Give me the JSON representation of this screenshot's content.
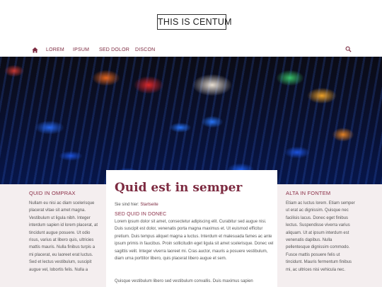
{
  "header": {
    "logo_text": "THIS IS CENTUM"
  },
  "nav": {
    "home_icon": "home-icon",
    "items": [
      {
        "label": "LOREM"
      },
      {
        "label": "IPSUM"
      },
      {
        "label": "SED DOLOR"
      },
      {
        "label": "DISCON"
      }
    ],
    "search_icon": "search-icon"
  },
  "colors": {
    "accent": "#7d2b41",
    "sidebar_bg": "#f4eeef"
  },
  "left_sidebar": {
    "title": "QUID IN OMPRAX",
    "text": "Nullam eu nisi ac diam scelerisque placerat vitae sit amet magna. Vestibulum ut ligula nibh. Integer interdum sapien id lorem placerat, at tincidunt augue posuere. Ut odio risus, varius at libero quis, ultricies mattis mauris. Nulla finibus turpis a mi placerat, eu laoreet erat luctus. Sed et lectus vestibulum, suscipit augue vel, lobortis felis. Nulla a"
  },
  "main": {
    "title": "Quid est in semper",
    "breadcrumb_prefix": "Sie sind hier:",
    "breadcrumb_link": "Startseite",
    "subtitle": "SED QUID IN DONEC",
    "paragraph1": "Lorem ipsum dolor sit amet, consectetur adipiscing elit. Curabitur sed augue nisi. Duis suscipit est dolor, venenatis porta magna maximus et. Ut euismod efficitur pretium. Duis tempus aliquet magna a luctus. Interdum et malesuada fames ac ante ipsum primis in faucibus. Proin sollicitudin eget ligula sit amet scelerisque. Donec vel sagittis velit. Integer viverra laoreet mi. Cras auctor, mauris a posuere vestibulum, diam urna porttitor libero, quis placerat libero augue et sem.",
    "paragraph2": "Quisque vestibulum libero sed vestibulum convallis. Duis maximus sapien"
  },
  "right_sidebar": {
    "title": "ALTA IN FONTEM",
    "text": "Etiam ac luctus lorem. Etiam semper ut erat ac dignissim. Quisque nec facilisis lacus. Donec eget finibus lectus. Suspendisse viverra varius aliquam. Ut at ipsum interdum est venenatis dapibus. Nulla pellentesque dignissim commodo. Fusce mattis posuere felis ut tincidunt. Mauris fermentum finibus mi, ac ultrices nisi vehicula nec."
  }
}
